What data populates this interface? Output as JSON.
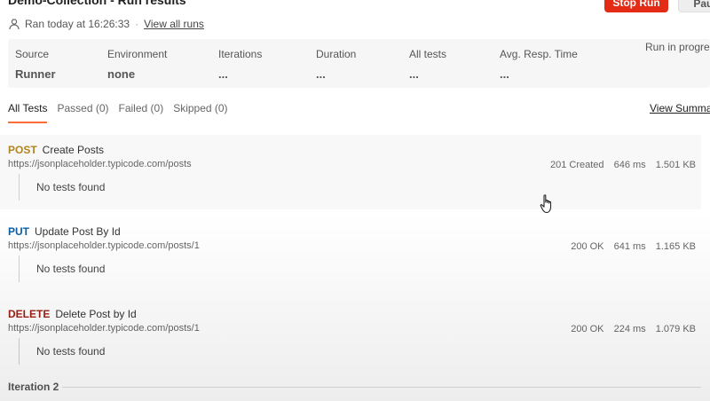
{
  "header": {
    "title": "Demo-Collection - Run results",
    "stop_label": "Stop Run",
    "pause_label": "Pause"
  },
  "run_info": {
    "ran_text": "Ran today at 16:26:33",
    "separator": "·",
    "view_all_runs": "View all runs"
  },
  "summary": {
    "source_label": "Source",
    "source_value": "Runner",
    "environment_label": "Environment",
    "environment_value": "none",
    "iterations_label": "Iterations",
    "iterations_value": "...",
    "duration_label": "Duration",
    "duration_value": "...",
    "all_tests_label": "All tests",
    "all_tests_value": "...",
    "avg_resp_label": "Avg. Resp. Time",
    "avg_resp_value": "...",
    "status": "Run in progress"
  },
  "tabs": {
    "all": "All Tests",
    "passed": "Passed (0)",
    "failed": "Failed (0)",
    "skipped": "Skipped (0)",
    "view_summary": "View Summary"
  },
  "requests": [
    {
      "method": "POST",
      "method_color": "#b1851e",
      "name": "Create Posts",
      "url": "https://jsonplaceholder.typicode.com/posts",
      "status": "201 Created",
      "time": "646 ms",
      "size": "1.501 KB",
      "tests": "No tests found"
    },
    {
      "method": "PUT",
      "method_color": "#0b5fa5",
      "name": "Update Post By Id",
      "url": "https://jsonplaceholder.typicode.com/posts/1",
      "status": "200 OK",
      "time": "641 ms",
      "size": "1.165 KB",
      "tests": "No tests found"
    },
    {
      "method": "DELETE",
      "method_color": "#9c1f14",
      "name": "Delete Post by Id",
      "url": "https://jsonplaceholder.typicode.com/posts/1",
      "status": "200 OK",
      "time": "224 ms",
      "size": "1.079 KB",
      "tests": "No tests found"
    }
  ],
  "iteration": {
    "label": "Iteration 2"
  },
  "icons": {
    "user": "user-icon",
    "cursor": "hand-pointer-icon"
  },
  "colors": {
    "stop_button": "#e32b16",
    "active_tab": "#ff6c37"
  }
}
